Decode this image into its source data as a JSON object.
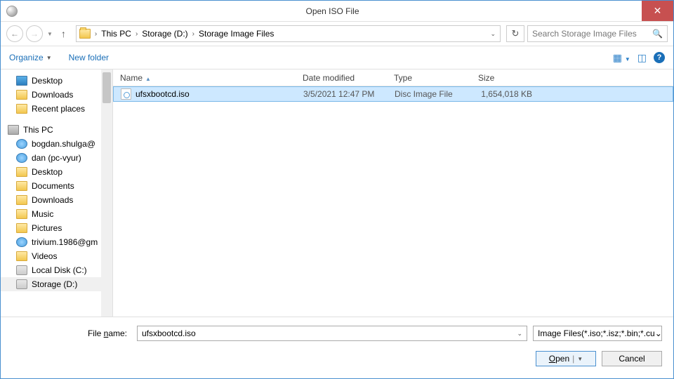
{
  "window": {
    "title": "Open ISO File"
  },
  "nav": {
    "breadcrumb": [
      "This PC",
      "Storage (D:)",
      "Storage Image Files"
    ],
    "search_placeholder": "Search Storage Image Files"
  },
  "toolbar": {
    "organize": "Organize",
    "new_folder": "New folder"
  },
  "tree": {
    "items": [
      {
        "label": "Desktop",
        "icon": "monitor"
      },
      {
        "label": "Downloads",
        "icon": "folder"
      },
      {
        "label": "Recent places",
        "icon": "folder"
      }
    ],
    "root2": {
      "label": "This PC",
      "icon": "pc"
    },
    "items2": [
      {
        "label": "bogdan.shulga@",
        "icon": "net"
      },
      {
        "label": "dan (pc-vyur)",
        "icon": "net"
      },
      {
        "label": "Desktop",
        "icon": "folder"
      },
      {
        "label": "Documents",
        "icon": "folder"
      },
      {
        "label": "Downloads",
        "icon": "folder"
      },
      {
        "label": "Music",
        "icon": "folder"
      },
      {
        "label": "Pictures",
        "icon": "folder"
      },
      {
        "label": "trivium.1986@gm",
        "icon": "net"
      },
      {
        "label": "Videos",
        "icon": "folder"
      },
      {
        "label": "Local Disk (C:)",
        "icon": "drive"
      },
      {
        "label": "Storage (D:)",
        "icon": "drive",
        "selected": true
      }
    ]
  },
  "list": {
    "columns": {
      "name": "Name",
      "date": "Date modified",
      "type": "Type",
      "size": "Size"
    },
    "rows": [
      {
        "name": "ufsxbootcd.iso",
        "date": "3/5/2021 12:47 PM",
        "type": "Disc Image File",
        "size": "1,654,018 KB",
        "selected": true
      }
    ]
  },
  "footer": {
    "filename_label_pre": "File ",
    "filename_label_u": "n",
    "filename_label_post": "ame:",
    "filename_value": "ufsxbootcd.iso",
    "filter": "Image Files(*.iso;*.isz;*.bin;*.cu",
    "open_u": "O",
    "open_rest": "pen",
    "cancel": "Cancel"
  }
}
